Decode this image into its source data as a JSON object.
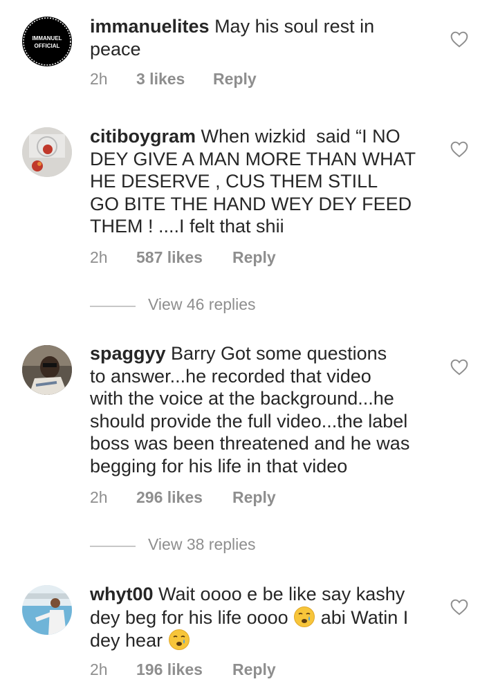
{
  "comments": [
    {
      "username": "immanuelites",
      "text": " May his soul rest in\npeace",
      "time": "2h",
      "likes": "3 likes",
      "reply": "Reply",
      "avatar_text": [
        "IMMANUEL",
        "OFFICIAL"
      ]
    },
    {
      "username": "citiboygram",
      "text": " When wizkid  said “I NO\nDEY GIVE A MAN MORE THAN WHAT\nHE DESERVE , CUS THEM STILL\nGO BITE THE HAND WEY DEY FEED\nTHEM ! ....I felt that shii",
      "time": "2h",
      "likes": "587 likes",
      "reply": "Reply",
      "view_replies": "View 46 replies"
    },
    {
      "username": "spaggyy",
      "text": " Barry Got some questions\nto answer...he recorded that video\nwith the voice at the background...he\nshould provide the full video...the label\nboss was been threatened and he was\nbegging for his life in that video",
      "time": "2h",
      "likes": "296 likes",
      "reply": "Reply",
      "view_replies": "View 38 replies"
    },
    {
      "username": "whyt00",
      "text_parts": [
        " Wait oooo e be like say kashy\ndey beg for his life oooo ",
        " abi Watin I\ndey hear "
      ],
      "time": "2h",
      "likes": "196 likes",
      "reply": "Reply"
    }
  ],
  "icons": {
    "like": "heart-outline-icon",
    "emoji": "crying-face-emoji"
  },
  "colors": {
    "text": "#262626",
    "meta": "#8e8e8e",
    "divider": "#c7c7c7"
  }
}
